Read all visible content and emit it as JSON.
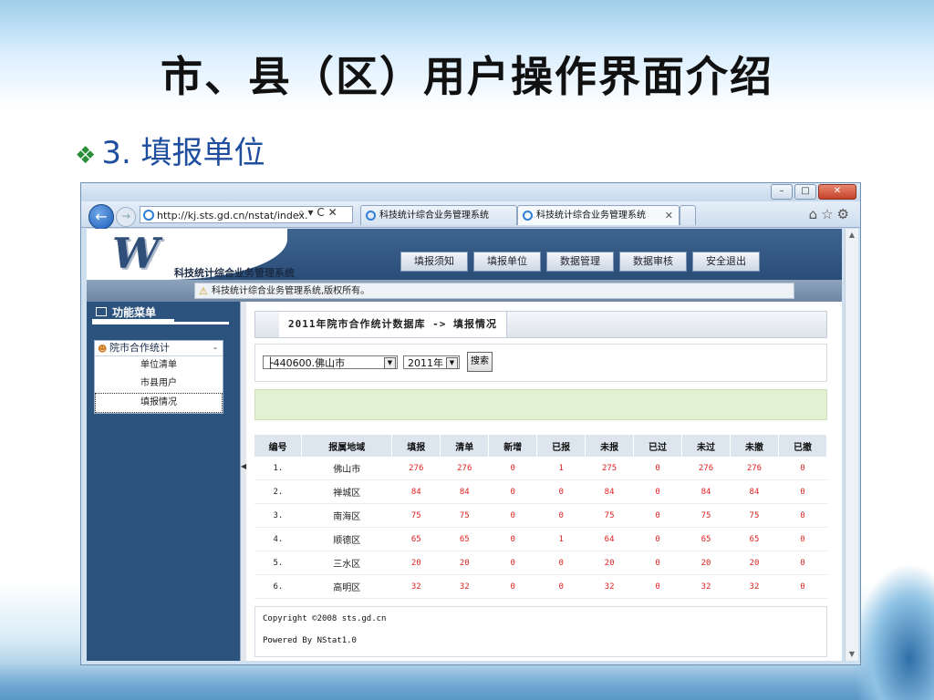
{
  "slide": {
    "title": "市、县（区）用户操作界面介绍",
    "bullet_mark": "❖",
    "bullet": "3. 填报单位"
  },
  "browser": {
    "url": "http://kj.sts.gd.cn/nstat/index.",
    "addr_tools": "⌕ ▾ C ✕",
    "tabs": [
      "科技统计综合业务管理系统",
      "科技统计综合业务管理系统"
    ],
    "tab_close": "✕",
    "right_icons": "⌂☆⚙",
    "win_buttons": {
      "minimize": "–",
      "maximize": "□",
      "close": "✕"
    }
  },
  "app": {
    "logo": "W",
    "system_name": "科技统计综合业务管理系统",
    "nav": [
      "填报须知",
      "填报单位",
      "数据管理",
      "数据审核",
      "安全退出"
    ],
    "notice": "科技统计综合业务管理系统,版权所有。",
    "sidebar": {
      "tab": "功能菜单",
      "group": "院市合作统计",
      "collapse": "-",
      "items": [
        "单位清单",
        "市县用户",
        "填报情况"
      ]
    },
    "breadcrumb": "2011年院市合作统计数据库 -> 填报情况",
    "filter": {
      "region": "├440600.佛山市",
      "year": "2011年",
      "search": "搜索"
    },
    "table": {
      "headers": [
        "编号",
        "报属地域",
        "填报",
        "清单",
        "新增",
        "已报",
        "未报",
        "已过",
        "未过",
        "未撤",
        "已撤"
      ],
      "rows": [
        [
          "1.",
          "佛山市",
          "276",
          "276",
          "0",
          "1",
          "275",
          "0",
          "276",
          "276",
          "0"
        ],
        [
          "2.",
          "禅城区",
          "84",
          "84",
          "0",
          "0",
          "84",
          "0",
          "84",
          "84",
          "0"
        ],
        [
          "3.",
          "南海区",
          "75",
          "75",
          "0",
          "0",
          "75",
          "0",
          "75",
          "75",
          "0"
        ],
        [
          "4.",
          "顺德区",
          "65",
          "65",
          "0",
          "1",
          "64",
          "0",
          "65",
          "65",
          "0"
        ],
        [
          "5.",
          "三水区",
          "20",
          "20",
          "0",
          "0",
          "20",
          "0",
          "20",
          "20",
          "0"
        ],
        [
          "6.",
          "高明区",
          "32",
          "32",
          "0",
          "0",
          "32",
          "0",
          "32",
          "32",
          "0"
        ]
      ]
    },
    "footer": [
      "Copyright ©2008 sts.gd.cn",
      "Powered By NStat1.0"
    ]
  },
  "colors": {
    "header_blue": "#2c527e",
    "accent_red": "#e02020",
    "green_bar": "#e3f1d3"
  }
}
